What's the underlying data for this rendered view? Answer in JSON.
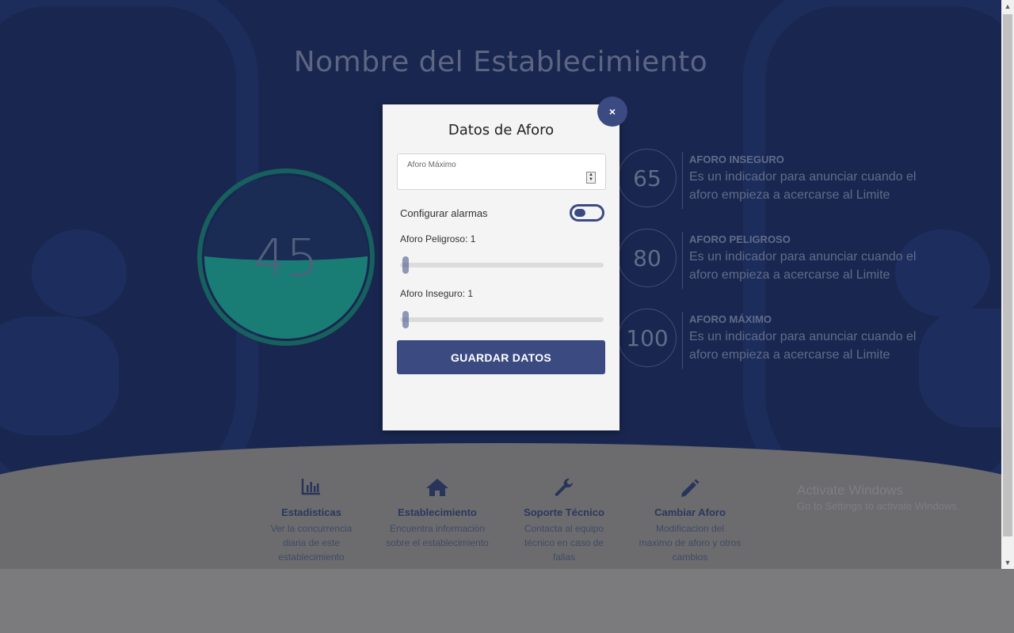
{
  "page": {
    "title": "Nombre del Establecimiento",
    "gauge_value": "45",
    "thresholds": [
      {
        "value": "65",
        "title": "AFORO INSEGURO",
        "desc": "Es un indicador para anunciar cuando el aforo empieza a acercarse al Limite"
      },
      {
        "value": "80",
        "title": "AFORO PELIGROSO",
        "desc": "Es un indicador para anunciar cuando el aforo empieza a acercarse al Limite"
      },
      {
        "value": "100",
        "title": "AFORO MÁXIMO",
        "desc": "Es un indicador para anunciar cuando el aforo empieza a acercarse al Limite"
      }
    ]
  },
  "features": [
    {
      "icon": "bar-chart-icon",
      "title": "Estadisticas",
      "desc": "Ver la concurrencia diaria de este establecimiento"
    },
    {
      "icon": "home-icon",
      "title": "Establecimiento",
      "desc": "Encuentra información sobre el establecimiento"
    },
    {
      "icon": "wrench-icon",
      "title": "Soporte Técnico",
      "desc": "Contacta al equipo técnico en caso de fallas"
    },
    {
      "icon": "pencil-icon",
      "title": "Cambiar Aforo",
      "desc": "Modificacion del maximo de aforo y otros cambios"
    }
  ],
  "watermark": {
    "line1": "Activate Windows",
    "line2": "Go to Settings to activate Windows."
  },
  "modal": {
    "close_label": "×",
    "title": "Datos de Aforo",
    "max_field_label": "Aforo Máximo",
    "max_field_value": "",
    "alarms_label": "Configurar alarmas",
    "alarms_enabled": false,
    "dangerous_label": "Aforo Peligroso: 1",
    "dangerous_value": 1,
    "unsafe_label": "Aforo Inseguro: 1",
    "unsafe_value": 1,
    "save_label": "GUARDAR DATOS"
  },
  "colors": {
    "background": "#1d2d5c",
    "accent": "#3b4b82",
    "gauge": "#1e8f86"
  }
}
